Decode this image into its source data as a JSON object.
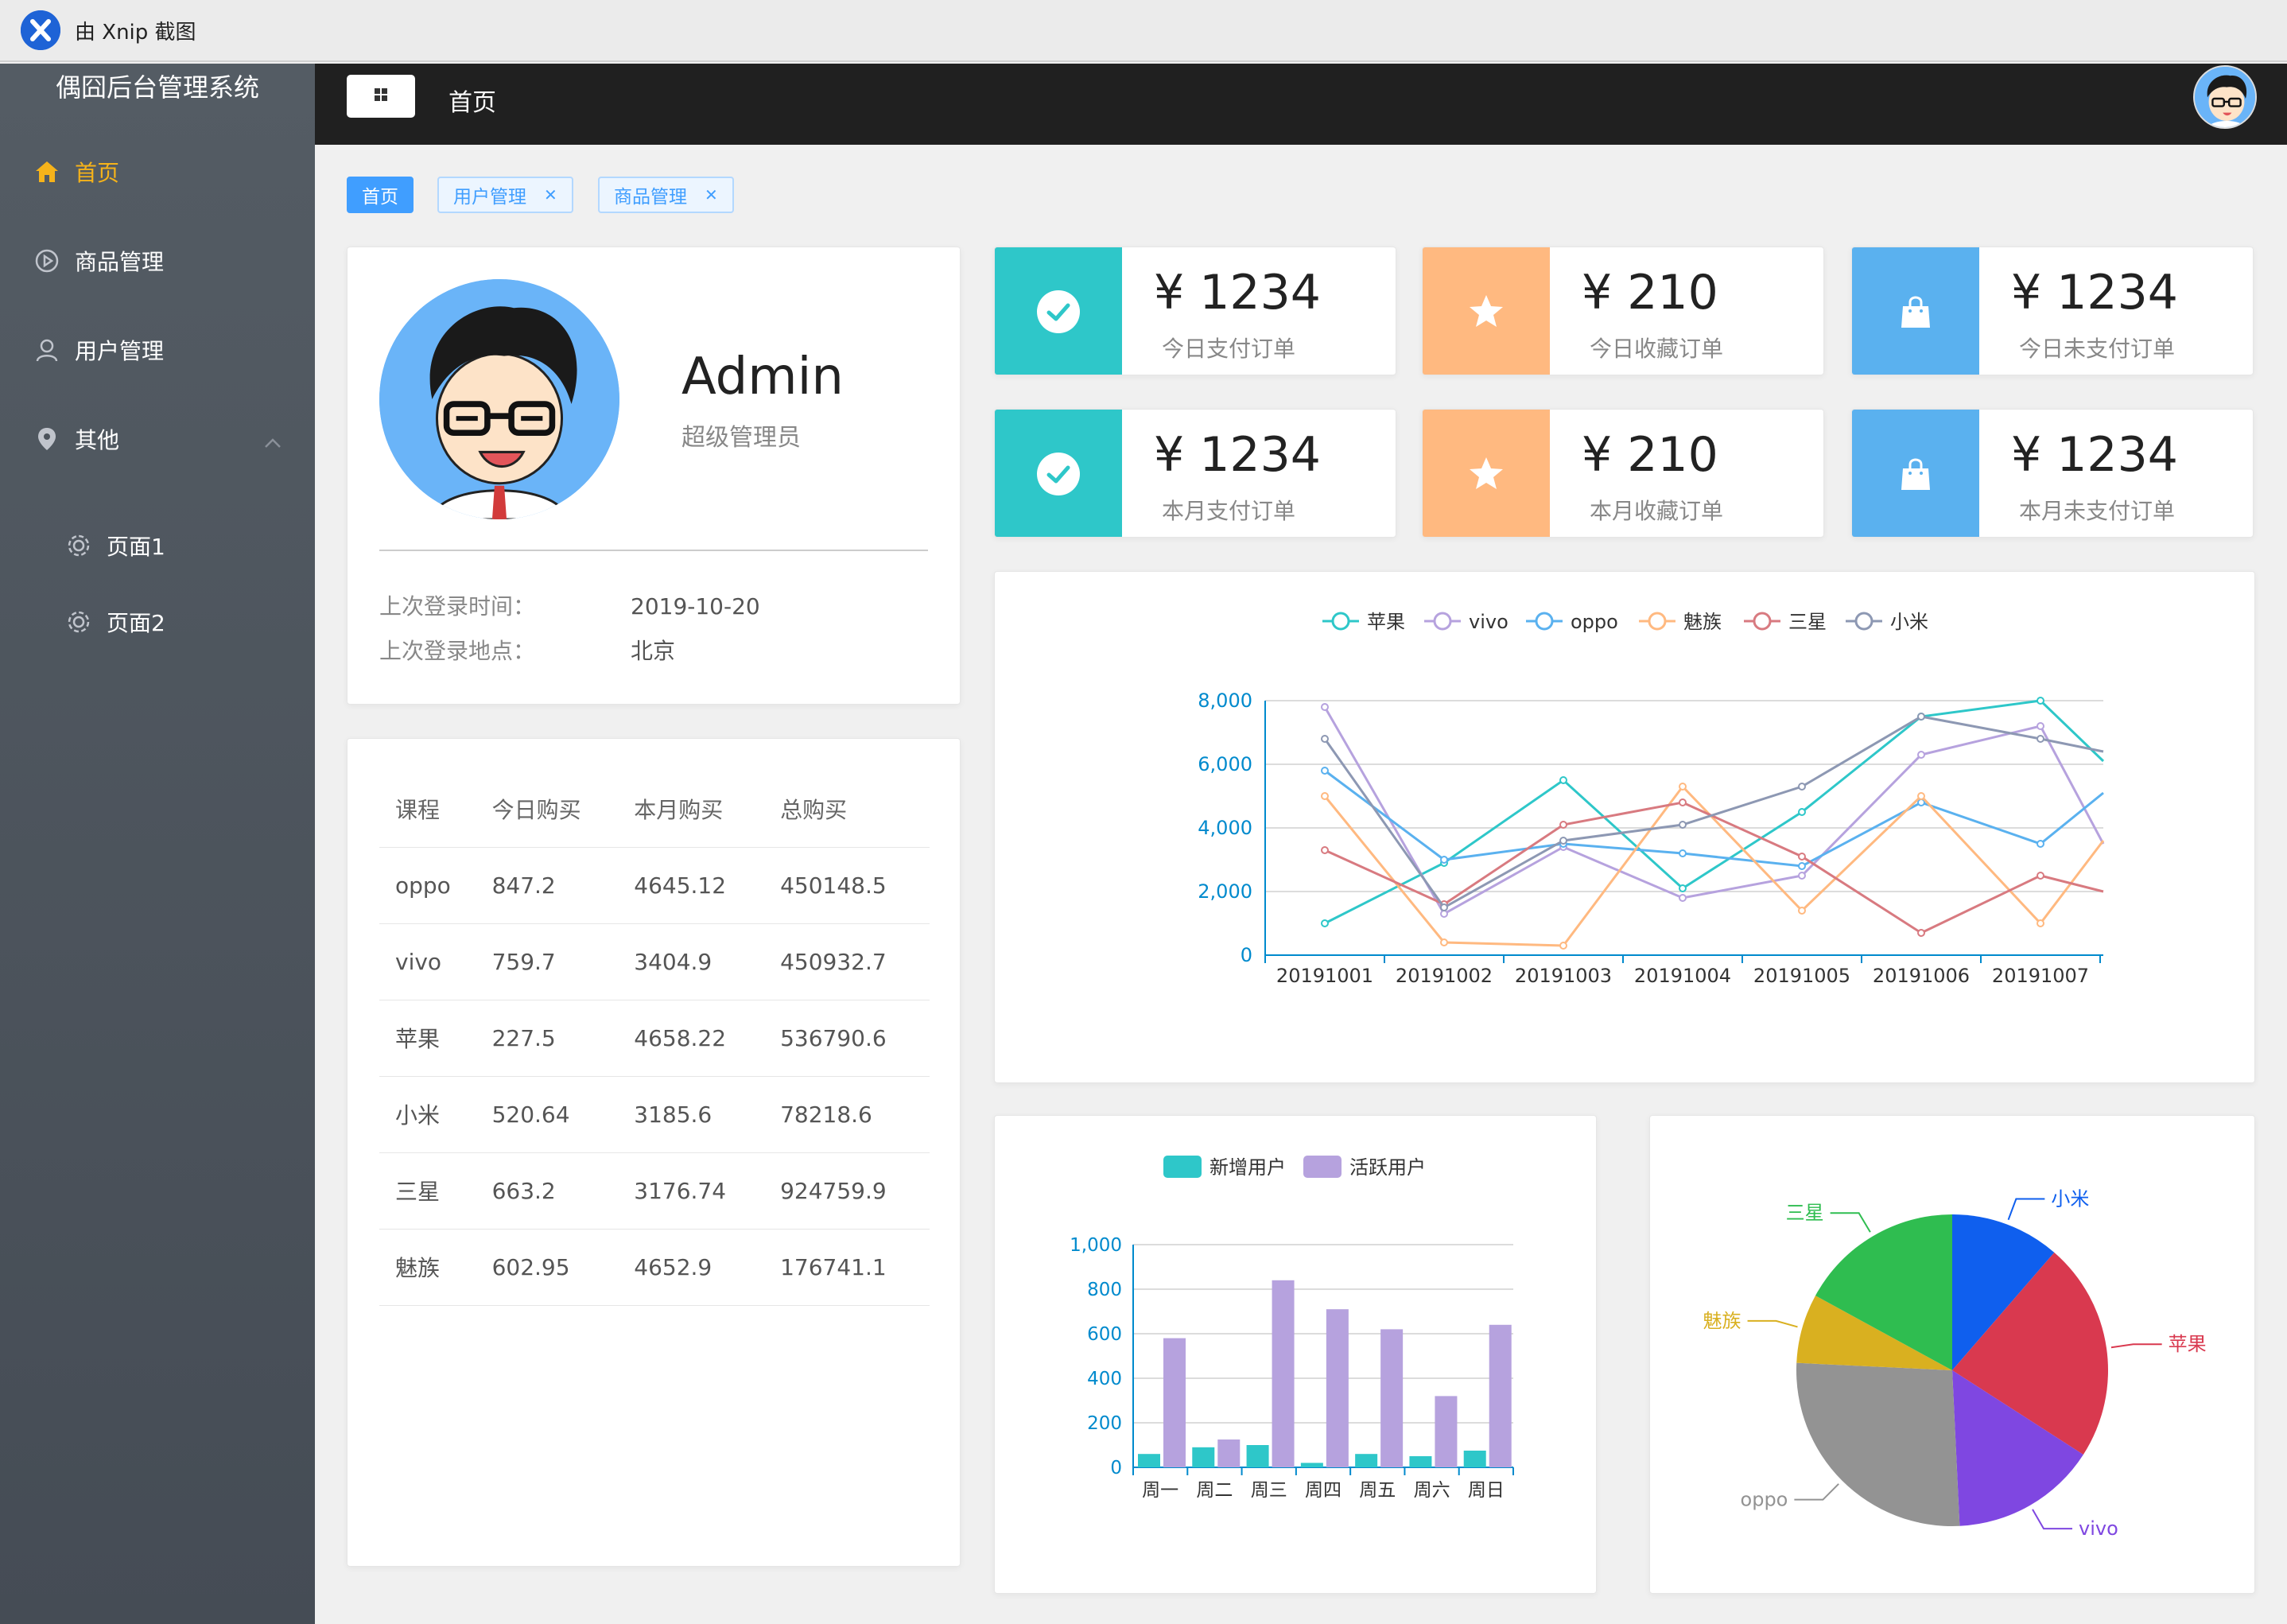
{
  "window": {
    "title": "由 Xnip 截图"
  },
  "sidebar": {
    "brand": "偶囧后台管理系统",
    "items": [
      {
        "label": "首页",
        "icon": "home-icon",
        "active": true
      },
      {
        "label": "商品管理",
        "icon": "play-circle-icon"
      },
      {
        "label": "用户管理",
        "icon": "user-icon"
      },
      {
        "label": "其他",
        "icon": "location-icon",
        "expanded": true
      }
    ],
    "subitems": [
      {
        "label": "页面1",
        "icon": "gear-icon"
      },
      {
        "label": "页面2",
        "icon": "gear-icon"
      }
    ]
  },
  "header": {
    "page_name": "首页"
  },
  "tags": [
    {
      "label": "首页",
      "active": true
    },
    {
      "label": "用户管理",
      "closable": true
    },
    {
      "label": "商品管理",
      "closable": true
    }
  ],
  "user": {
    "name": "Admin",
    "role": "超级管理员",
    "last_login_time_label": "上次登录时间：",
    "last_login_time": "2019-10-20",
    "last_login_place_label": "上次登录地点：",
    "last_login_place": "北京"
  },
  "purchase_table": {
    "headers": [
      "课程",
      "今日购买",
      "本月购买",
      "总购买"
    ],
    "rows": [
      [
        "oppo",
        "847.2",
        "4645.12",
        "450148.5"
      ],
      [
        "vivo",
        "759.7",
        "3404.9",
        "450932.7"
      ],
      [
        "苹果",
        "227.5",
        "4658.22",
        "536790.6"
      ],
      [
        "小米",
        "520.64",
        "3185.6",
        "78218.6"
      ],
      [
        "三星",
        "663.2",
        "3176.74",
        "924759.9"
      ],
      [
        "魅族",
        "602.95",
        "4652.9",
        "176741.1"
      ]
    ]
  },
  "stats": [
    {
      "value": "¥ 1234",
      "label": "今日支付订单",
      "color": "#2ec7c9",
      "icon": "check-circle-icon"
    },
    {
      "value": "¥ 210",
      "label": "今日收藏订单",
      "color": "#ffb980",
      "icon": "star-icon"
    },
    {
      "value": "¥ 1234",
      "label": "今日未支付订单",
      "color": "#5ab1ef",
      "icon": "shopping-bag-icon"
    },
    {
      "value": "¥ 1234",
      "label": "本月支付订单",
      "color": "#2ec7c9",
      "icon": "check-circle-icon"
    },
    {
      "value": "¥ 210",
      "label": "本月收藏订单",
      "color": "#ffb980",
      "icon": "star-icon"
    },
    {
      "value": "¥ 1234",
      "label": "本月未支付订单",
      "color": "#5ab1ef",
      "icon": "shopping-bag-icon"
    }
  ],
  "chart_data": [
    {
      "type": "line",
      "x": [
        "20191001",
        "20191002",
        "20191003",
        "20191004",
        "20191005",
        "20191006",
        "20191007"
      ],
      "ylim": [
        0,
        8000
      ],
      "yticks": [
        0,
        2000,
        4000,
        6000,
        8000
      ],
      "grid": true,
      "legend": "top-center",
      "series": [
        {
          "name": "苹果",
          "color": "#2ec7c9",
          "values": [
            1000,
            2900,
            5500,
            2100,
            4500,
            7500,
            8000,
            6100
          ]
        },
        {
          "name": "vivo",
          "color": "#b6a2de",
          "values": [
            7800,
            1300,
            3400,
            1800,
            2500,
            6300,
            7200,
            3500
          ]
        },
        {
          "name": "oppo",
          "color": "#5ab1ef",
          "values": [
            5800,
            3000,
            3500,
            3200,
            2800,
            4800,
            3500,
            5100
          ]
        },
        {
          "name": "魅族",
          "color": "#ffb980",
          "values": [
            5000,
            400,
            300,
            5300,
            1400,
            5000,
            1000,
            3600
          ]
        },
        {
          "name": "三星",
          "color": "#d87a80",
          "values": [
            3300,
            1600,
            4100,
            4800,
            3100,
            700,
            2500,
            2000
          ]
        },
        {
          "name": "小米",
          "color": "#8d98b3",
          "values": [
            6800,
            1500,
            3600,
            4100,
            5300,
            7500,
            6800,
            6400
          ]
        }
      ]
    },
    {
      "type": "bar",
      "categories": [
        "周一",
        "周二",
        "周三",
        "周四",
        "周五",
        "周六",
        "周日"
      ],
      "ylim": [
        0,
        1000
      ],
      "yticks": [
        0,
        200,
        400,
        600,
        800,
        1000
      ],
      "grid": true,
      "legend": "top-center",
      "series": [
        {
          "name": "新增用户",
          "color": "#2ec7c9",
          "values": [
            60,
            90,
            100,
            20,
            60,
            50,
            75
          ]
        },
        {
          "name": "活跃用户",
          "color": "#b6a2de",
          "values": [
            580,
            125,
            840,
            710,
            620,
            320,
            640
          ]
        }
      ]
    },
    {
      "type": "pie",
      "legend": "none",
      "slices": [
        {
          "name": "小米",
          "value": 2999,
          "color": "#0f5fee"
        },
        {
          "name": "苹果",
          "value": 5999,
          "color": "#d9394f"
        },
        {
          "name": "vivo",
          "value": 3999,
          "color": "#7f47e1"
        },
        {
          "name": "oppo",
          "value": 6999,
          "color": "#939393"
        },
        {
          "name": "魅族",
          "value": 1899,
          "color": "#d9b020"
        },
        {
          "name": "三星",
          "value": 4500,
          "color": "#2fbd50"
        }
      ]
    }
  ]
}
